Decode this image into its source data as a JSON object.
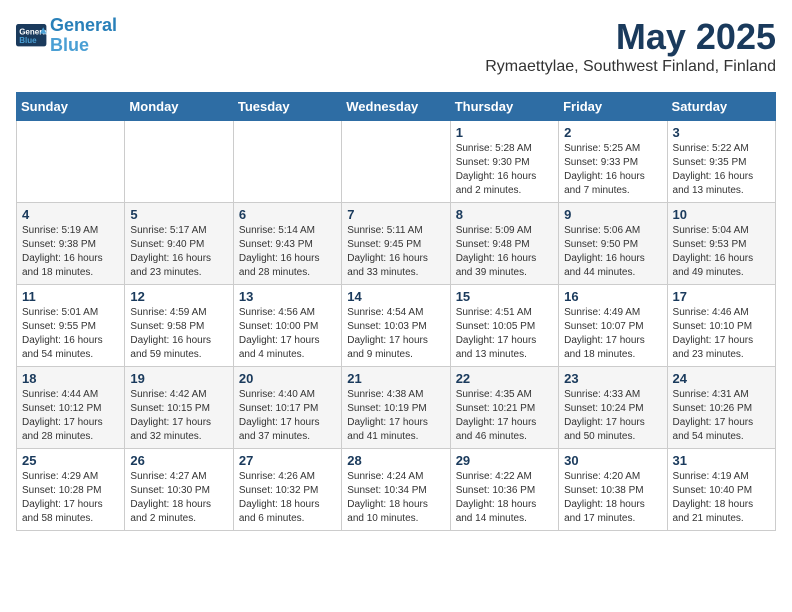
{
  "app": {
    "logo_line1": "General",
    "logo_line2": "Blue"
  },
  "header": {
    "month": "May 2025",
    "location": "Rymaettylae, Southwest Finland, Finland"
  },
  "weekdays": [
    "Sunday",
    "Monday",
    "Tuesday",
    "Wednesday",
    "Thursday",
    "Friday",
    "Saturday"
  ],
  "weeks": [
    [
      {
        "day": "",
        "info": ""
      },
      {
        "day": "",
        "info": ""
      },
      {
        "day": "",
        "info": ""
      },
      {
        "day": "",
        "info": ""
      },
      {
        "day": "1",
        "info": "Sunrise: 5:28 AM\nSunset: 9:30 PM\nDaylight: 16 hours and 2 minutes."
      },
      {
        "day": "2",
        "info": "Sunrise: 5:25 AM\nSunset: 9:33 PM\nDaylight: 16 hours and 7 minutes."
      },
      {
        "day": "3",
        "info": "Sunrise: 5:22 AM\nSunset: 9:35 PM\nDaylight: 16 hours and 13 minutes."
      }
    ],
    [
      {
        "day": "4",
        "info": "Sunrise: 5:19 AM\nSunset: 9:38 PM\nDaylight: 16 hours and 18 minutes."
      },
      {
        "day": "5",
        "info": "Sunrise: 5:17 AM\nSunset: 9:40 PM\nDaylight: 16 hours and 23 minutes."
      },
      {
        "day": "6",
        "info": "Sunrise: 5:14 AM\nSunset: 9:43 PM\nDaylight: 16 hours and 28 minutes."
      },
      {
        "day": "7",
        "info": "Sunrise: 5:11 AM\nSunset: 9:45 PM\nDaylight: 16 hours and 33 minutes."
      },
      {
        "day": "8",
        "info": "Sunrise: 5:09 AM\nSunset: 9:48 PM\nDaylight: 16 hours and 39 minutes."
      },
      {
        "day": "9",
        "info": "Sunrise: 5:06 AM\nSunset: 9:50 PM\nDaylight: 16 hours and 44 minutes."
      },
      {
        "day": "10",
        "info": "Sunrise: 5:04 AM\nSunset: 9:53 PM\nDaylight: 16 hours and 49 minutes."
      }
    ],
    [
      {
        "day": "11",
        "info": "Sunrise: 5:01 AM\nSunset: 9:55 PM\nDaylight: 16 hours and 54 minutes."
      },
      {
        "day": "12",
        "info": "Sunrise: 4:59 AM\nSunset: 9:58 PM\nDaylight: 16 hours and 59 minutes."
      },
      {
        "day": "13",
        "info": "Sunrise: 4:56 AM\nSunset: 10:00 PM\nDaylight: 17 hours and 4 minutes."
      },
      {
        "day": "14",
        "info": "Sunrise: 4:54 AM\nSunset: 10:03 PM\nDaylight: 17 hours and 9 minutes."
      },
      {
        "day": "15",
        "info": "Sunrise: 4:51 AM\nSunset: 10:05 PM\nDaylight: 17 hours and 13 minutes."
      },
      {
        "day": "16",
        "info": "Sunrise: 4:49 AM\nSunset: 10:07 PM\nDaylight: 17 hours and 18 minutes."
      },
      {
        "day": "17",
        "info": "Sunrise: 4:46 AM\nSunset: 10:10 PM\nDaylight: 17 hours and 23 minutes."
      }
    ],
    [
      {
        "day": "18",
        "info": "Sunrise: 4:44 AM\nSunset: 10:12 PM\nDaylight: 17 hours and 28 minutes."
      },
      {
        "day": "19",
        "info": "Sunrise: 4:42 AM\nSunset: 10:15 PM\nDaylight: 17 hours and 32 minutes."
      },
      {
        "day": "20",
        "info": "Sunrise: 4:40 AM\nSunset: 10:17 PM\nDaylight: 17 hours and 37 minutes."
      },
      {
        "day": "21",
        "info": "Sunrise: 4:38 AM\nSunset: 10:19 PM\nDaylight: 17 hours and 41 minutes."
      },
      {
        "day": "22",
        "info": "Sunrise: 4:35 AM\nSunset: 10:21 PM\nDaylight: 17 hours and 46 minutes."
      },
      {
        "day": "23",
        "info": "Sunrise: 4:33 AM\nSunset: 10:24 PM\nDaylight: 17 hours and 50 minutes."
      },
      {
        "day": "24",
        "info": "Sunrise: 4:31 AM\nSunset: 10:26 PM\nDaylight: 17 hours and 54 minutes."
      }
    ],
    [
      {
        "day": "25",
        "info": "Sunrise: 4:29 AM\nSunset: 10:28 PM\nDaylight: 17 hours and 58 minutes."
      },
      {
        "day": "26",
        "info": "Sunrise: 4:27 AM\nSunset: 10:30 PM\nDaylight: 18 hours and 2 minutes."
      },
      {
        "day": "27",
        "info": "Sunrise: 4:26 AM\nSunset: 10:32 PM\nDaylight: 18 hours and 6 minutes."
      },
      {
        "day": "28",
        "info": "Sunrise: 4:24 AM\nSunset: 10:34 PM\nDaylight: 18 hours and 10 minutes."
      },
      {
        "day": "29",
        "info": "Sunrise: 4:22 AM\nSunset: 10:36 PM\nDaylight: 18 hours and 14 minutes."
      },
      {
        "day": "30",
        "info": "Sunrise: 4:20 AM\nSunset: 10:38 PM\nDaylight: 18 hours and 17 minutes."
      },
      {
        "day": "31",
        "info": "Sunrise: 4:19 AM\nSunset: 10:40 PM\nDaylight: 18 hours and 21 minutes."
      }
    ]
  ]
}
